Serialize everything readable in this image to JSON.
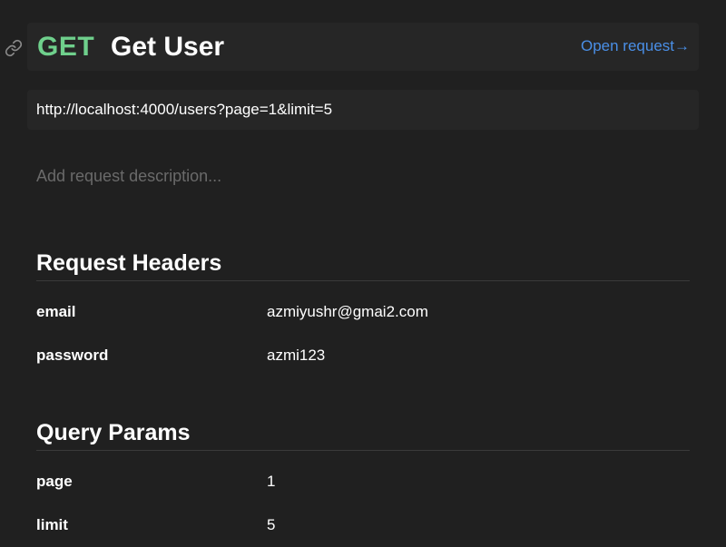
{
  "request": {
    "method": "GET",
    "name": "Get User",
    "open_link": "Open request→",
    "url": "http://localhost:4000/users?page=1&limit=5",
    "description_placeholder": "Add request description...",
    "method_color": "#6fd08c",
    "link_color": "#4a8fe7"
  },
  "headers": {
    "title": "Request Headers",
    "rows": [
      {
        "key": "email",
        "value": "azmiyushr@gmai2.com"
      },
      {
        "key": "password",
        "value": "azmi123"
      }
    ]
  },
  "params": {
    "title": "Query Params",
    "rows": [
      {
        "key": "page",
        "value": "1"
      },
      {
        "key": "limit",
        "value": "5"
      }
    ]
  },
  "icons": {
    "anchor": "link-icon"
  }
}
